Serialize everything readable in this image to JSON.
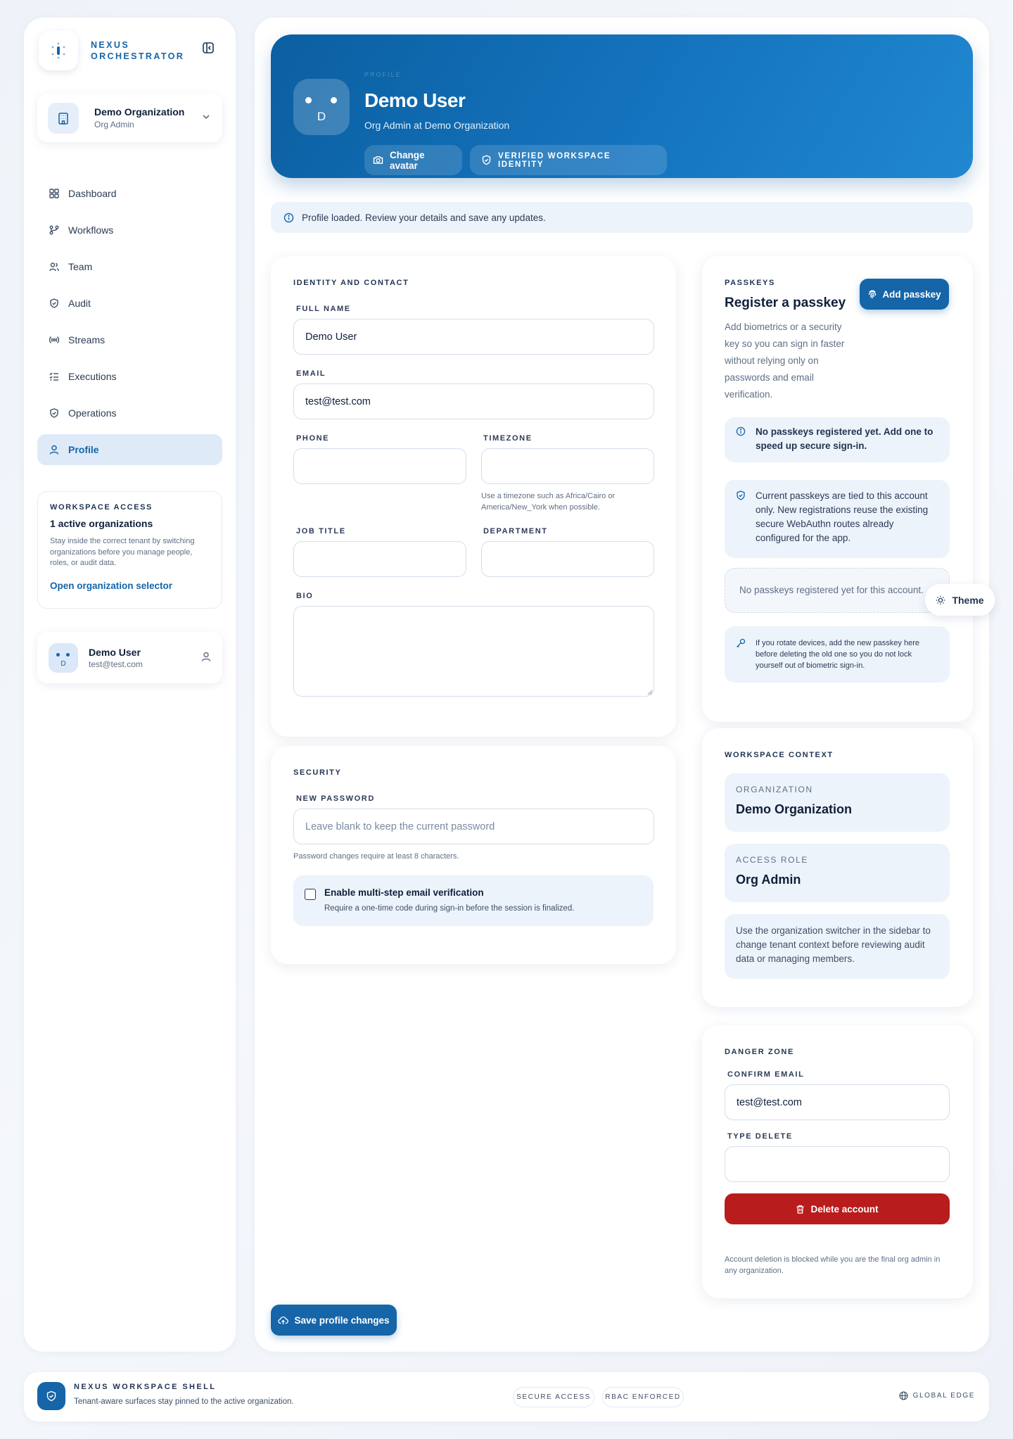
{
  "brand": {
    "line1": "NEXUS",
    "line2": "ORCHESTRATOR"
  },
  "org_switcher": {
    "name": "Demo Organization",
    "role": "Org Admin"
  },
  "nav": [
    {
      "label": "Dashboard",
      "icon": "dashboard-icon"
    },
    {
      "label": "Workflows",
      "icon": "workflow-icon"
    },
    {
      "label": "Team",
      "icon": "team-icon"
    },
    {
      "label": "Audit",
      "icon": "shield-check-icon"
    },
    {
      "label": "Streams",
      "icon": "radio-icon"
    },
    {
      "label": "Executions",
      "icon": "list-check-icon"
    },
    {
      "label": "Operations",
      "icon": "shield-icon"
    },
    {
      "label": "Profile",
      "icon": "user-icon",
      "active": true
    }
  ],
  "workspace_access": {
    "label": "WORKSPACE ACCESS",
    "title": "1 active organizations",
    "description": "Stay inside the correct tenant by switching organizations before you manage people, roles, or audit data.",
    "link": "Open organization selector"
  },
  "current_user": {
    "initial": "D",
    "name": "Demo User",
    "email": "test@test.com"
  },
  "hero": {
    "eyebrow": "PROFILE",
    "name": "Demo User",
    "subtitle": "Org Admin at Demo Organization",
    "change_avatar": "Change avatar",
    "badge": "VERIFIED WORKSPACE IDENTITY",
    "initial": "D"
  },
  "notice": "Profile loaded. Review your details and save any updates.",
  "identity": {
    "section": "IDENTITY AND CONTACT",
    "full_name_label": "FULL NAME",
    "full_name": "Demo User",
    "email_label": "EMAIL",
    "email": "test@test.com",
    "phone_label": "PHONE",
    "phone": "",
    "timezone_label": "TIMEZONE",
    "timezone": "",
    "timezone_hint": "Use a timezone such as Africa/Cairo or America/New_York when possible.",
    "job_title_label": "JOB TITLE",
    "job_title": "",
    "department_label": "DEPARTMENT",
    "department": "",
    "bio_label": "BIO",
    "bio": ""
  },
  "security": {
    "section": "SECURITY",
    "new_password_label": "NEW PASSWORD",
    "new_password_placeholder": "Leave blank to keep the current password",
    "password_hint": "Password changes require at least 8 characters.",
    "mfa_title": "Enable multi-step email verification",
    "mfa_sub": "Require a one-time code during sign-in before the session is finalized.",
    "mfa_checked": false
  },
  "passkeys": {
    "section": "PASSKEYS",
    "title": "Register a passkey",
    "add_button": "Add passkey",
    "description": "Add biometrics or a security key so you can sign in faster without relying only on passwords and email verification.",
    "none_notice": "No passkeys registered yet. Add one to speed up secure sign-in.",
    "tied_notice": "Current passkeys are tied to this account only. New registrations reuse the existing secure WebAuthn routes already configured for the app.",
    "empty_list": "No passkeys registered yet for this account.",
    "rotate_tip": "If you rotate devices, add the new passkey here before deleting the old one so you do not lock yourself out of biometric sign-in."
  },
  "theme_button": "Theme",
  "workspace_context": {
    "section": "WORKSPACE CONTEXT",
    "org_label": "ORGANIZATION",
    "org_value": "Demo Organization",
    "role_label": "ACCESS ROLE",
    "role_value": "Org Admin",
    "note": "Use the organization switcher in the sidebar to change tenant context before reviewing audit data or managing members."
  },
  "danger_zone": {
    "section": "DANGER ZONE",
    "confirm_email_label": "CONFIRM EMAIL",
    "confirm_email": "test@test.com",
    "type_delete_label": "TYPE DELETE",
    "type_delete": "",
    "delete_button": "Delete account",
    "note": "Account deletion is blocked while you are the final org admin in any organization."
  },
  "save_button": "Save profile changes",
  "footer": {
    "title": "NEXUS WORKSPACE SHELL",
    "subtitle": "Tenant-aware surfaces stay pinned to the active organization.",
    "chip1": "SECURE ACCESS",
    "chip2": "RBAC ENFORCED",
    "edge": "GLOBAL EDGE"
  },
  "colors": {
    "accent": "#1565a8",
    "danger": "#b91c1c",
    "panel": "#edf3fb"
  }
}
